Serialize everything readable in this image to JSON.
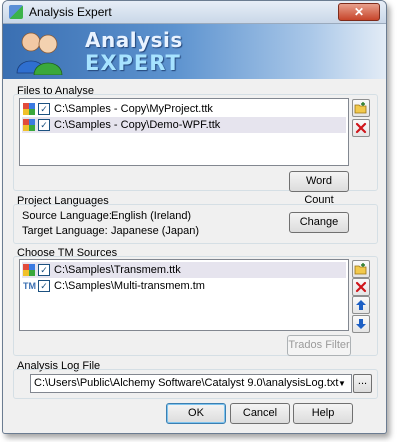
{
  "window": {
    "title": "Analysis Expert"
  },
  "banner": {
    "line1": "Analysis",
    "line2": "EXPERT"
  },
  "files": {
    "label": "Files to Analyse",
    "items": [
      {
        "path": "C:\\Samples - Copy\\MyProject.ttk",
        "checked": true,
        "selected": false
      },
      {
        "path": "C:\\Samples - Copy\\Demo-WPF.ttk",
        "checked": true,
        "selected": true
      }
    ],
    "word_count": "Word Count"
  },
  "languages": {
    "label": "Project Languages",
    "source_label": "Source Language:",
    "source_value": "English (Ireland)",
    "target_label": "Target Language:",
    "target_value": "Japanese (Japan)",
    "change": "Change"
  },
  "tm": {
    "label": "Choose TM Sources",
    "items": [
      {
        "path": "C:\\Samples\\Transmem.ttk",
        "checked": true,
        "selected": true
      },
      {
        "path": "C:\\Samples\\Multi-transmem.tm",
        "checked": true,
        "selected": false
      }
    ],
    "trados_filter": "Trados Filter",
    "tm_badge": "TM"
  },
  "log": {
    "label": "Analysis Log File",
    "value": "C:\\Users\\Public\\Alchemy Software\\Catalyst 9.0\\analysisLog.txt",
    "browse": "..."
  },
  "buttons": {
    "ok": "OK",
    "cancel": "Cancel",
    "help": "Help"
  },
  "close_glyph": "✕",
  "colors": {
    "banner": "#3a6fb2",
    "delete": "#d0161b",
    "arrow": "#1d5fc4"
  }
}
